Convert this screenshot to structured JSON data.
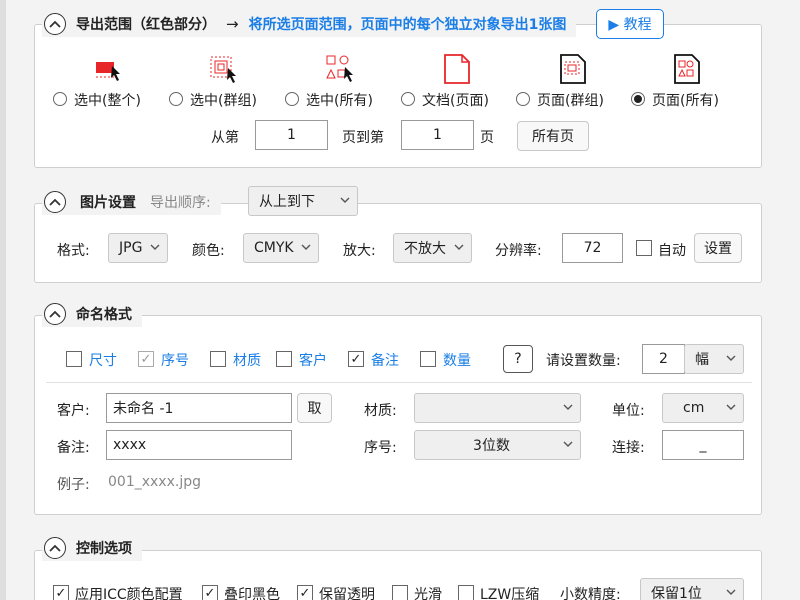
{
  "colors": {
    "accent_blue": "#1a7ee6",
    "icon_red": "#e8262a"
  },
  "export_range": {
    "title": "导出范围（红色部分）",
    "arrow": "→",
    "hint": "将所选页面范围，页面中的每个独立对象导出1张图",
    "tutorial_label": "▶ 教程",
    "options": [
      {
        "label": "选中(整个)",
        "icon": "selected-whole-icon",
        "checked": false
      },
      {
        "label": "选中(群组)",
        "icon": "selected-group-icon",
        "checked": false
      },
      {
        "label": "选中(所有)",
        "icon": "selected-all-icon",
        "checked": false
      },
      {
        "label": "文档(页面)",
        "icon": "document-page-icon",
        "checked": false
      },
      {
        "label": "页面(群组)",
        "icon": "page-group-icon",
        "checked": false
      },
      {
        "label": "页面(所有)",
        "icon": "page-all-icon",
        "checked": true
      }
    ],
    "from_label": "从第",
    "from_value": "1",
    "to_label": "页到第",
    "to_value": "1",
    "page_suffix": "页",
    "all_pages_label": "所有页"
  },
  "image_settings": {
    "title": "图片设置",
    "order_label": "导出顺序:",
    "order_value": "从上到下",
    "format_label": "格式:",
    "format_value": "JPG",
    "color_label": "颜色:",
    "color_value": "CMYK",
    "zoom_label": "放大:",
    "zoom_value": "不放大",
    "resolution_label": "分辨率:",
    "resolution_value": "72",
    "auto_label": "自动",
    "auto_checked": false,
    "settings_label": "设置"
  },
  "naming": {
    "title": "命名格式",
    "fields": [
      {
        "label": "尺寸",
        "checked": false,
        "disabled": false
      },
      {
        "label": "序号",
        "checked": true,
        "disabled": true
      },
      {
        "label": "材质",
        "checked": false,
        "disabled": false
      },
      {
        "label": "客户",
        "checked": false,
        "disabled": false
      },
      {
        "label": "备注",
        "checked": true,
        "disabled": false
      },
      {
        "label": "数量",
        "checked": false,
        "disabled": false
      }
    ],
    "help_label": "?",
    "quantity_label": "请设置数量:",
    "quantity_value": "2",
    "unit_select_value": "幅",
    "customer_label": "客户:",
    "customer_value": "未命名 -1",
    "fetch_label": "取",
    "material_label": "材质:",
    "material_value": "",
    "unit_label": "单位:",
    "unit_value": "cm",
    "note_label": "备注:",
    "note_value": "xxxx",
    "serial_label": "序号:",
    "serial_value": "3位数",
    "connector_label": "连接:",
    "connector_value": "_",
    "example_label": "例子:",
    "example_value": "001_xxxx.jpg"
  },
  "control": {
    "title": "控制选项",
    "options": [
      {
        "label": "应用ICC颜色配置",
        "checked": true
      },
      {
        "label": "叠印黑色",
        "checked": true
      },
      {
        "label": "保留透明",
        "checked": true
      },
      {
        "label": "光滑",
        "checked": false
      },
      {
        "label": "LZW压缩",
        "checked": false
      }
    ],
    "precision_label": "小数精度:",
    "precision_value": "保留1位"
  }
}
